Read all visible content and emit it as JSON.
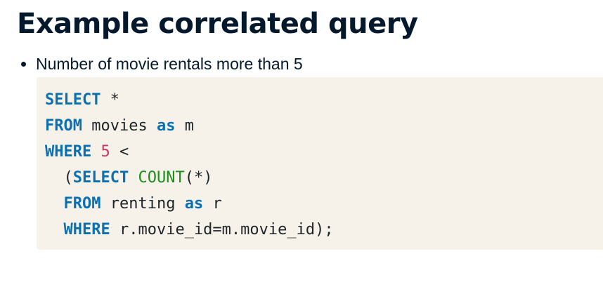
{
  "slide": {
    "title": "Example correlated query",
    "bullets": [
      "Number of movie rentals more than 5"
    ]
  },
  "code": {
    "lines": [
      {
        "indent": "",
        "tokens": [
          {
            "type": "kw",
            "text": "SELECT"
          },
          {
            "type": "plain",
            "text": " *"
          }
        ]
      },
      {
        "indent": "",
        "tokens": [
          {
            "type": "kw",
            "text": "FROM"
          },
          {
            "type": "plain",
            "text": " movies "
          },
          {
            "type": "kw",
            "text": "as"
          },
          {
            "type": "plain",
            "text": " m"
          }
        ]
      },
      {
        "indent": "",
        "tokens": [
          {
            "type": "kw",
            "text": "WHERE"
          },
          {
            "type": "plain",
            "text": " "
          },
          {
            "type": "num",
            "text": "5"
          },
          {
            "type": "plain",
            "text": " <"
          }
        ]
      },
      {
        "indent": "  ",
        "tokens": [
          {
            "type": "plain",
            "text": "("
          },
          {
            "type": "kw",
            "text": "SELECT"
          },
          {
            "type": "plain",
            "text": " "
          },
          {
            "type": "fn",
            "text": "COUNT"
          },
          {
            "type": "plain",
            "text": "(*)"
          }
        ]
      },
      {
        "indent": "  ",
        "tokens": [
          {
            "type": "kw",
            "text": "FROM"
          },
          {
            "type": "plain",
            "text": " renting "
          },
          {
            "type": "kw",
            "text": "as"
          },
          {
            "type": "plain",
            "text": " r"
          }
        ]
      },
      {
        "indent": "  ",
        "tokens": [
          {
            "type": "kw",
            "text": "WHERE"
          },
          {
            "type": "plain",
            "text": " r.movie_id=m.movie_id);"
          }
        ]
      }
    ]
  },
  "colors": {
    "keyword": "#0a70b0",
    "function": "#1a8f1a",
    "number": "#c9376a",
    "text": "#1f2428",
    "code_background": "#f6f2ea",
    "title": "#05192d"
  }
}
